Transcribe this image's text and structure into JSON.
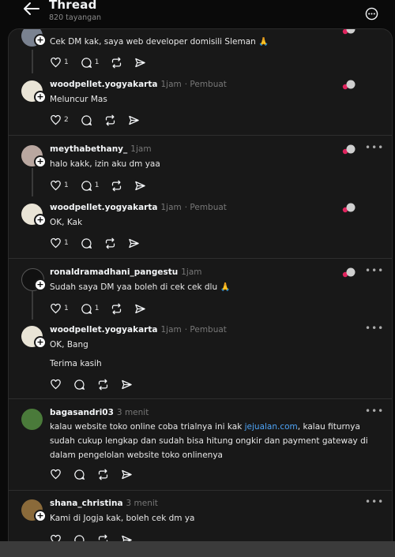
{
  "header": {
    "title": "Thread",
    "views": "820 tayangan"
  },
  "posts": [
    {
      "user": "",
      "time": "",
      "role": "",
      "text": "Cek DM kak, saya web developer domisili Sleman 🙏",
      "likes": "1",
      "replies": "1"
    },
    {
      "user": "woodpellet.yogyakarta",
      "time": "1jam",
      "role": "· Pembuat",
      "text": "Meluncur Mas",
      "likes": "2",
      "replies": ""
    },
    {
      "user": "meythabethany_",
      "time": "1jam",
      "role": "",
      "text": "halo kakk, izin aku dm yaa",
      "likes": "1",
      "replies": "1"
    },
    {
      "user": "woodpellet.yogyakarta",
      "time": "1jam",
      "role": "· Pembuat",
      "text": "OK, Kak",
      "likes": "1",
      "replies": ""
    },
    {
      "user": "ronaldramadhani_pangestu",
      "time": "1jam",
      "role": "",
      "text": "Sudah saya DM yaa boleh di cek cek dlu 🙏",
      "likes": "1",
      "replies": "1"
    },
    {
      "user": "woodpellet.yogyakarta",
      "time": "1jam",
      "role": "· Pembuat",
      "text": "OK, Bang",
      "text2": "Terima kasih",
      "likes": "",
      "replies": ""
    },
    {
      "user": "bagasandri03",
      "time": "3 menit",
      "role": "",
      "text_a": "kalau website toko online coba trialnya ini kak ",
      "text_link": "jejualan.com",
      "text_b": ", kalau fiturnya sudah cukup lengkap dan sudah bisa hitung ongkir dan payment gateway di dalam pengelolan website toko onlinenya",
      "likes": "",
      "replies": ""
    },
    {
      "user": "shana_christina",
      "time": "3 menit",
      "role": "",
      "text": "Kami di Jogja kak, boleh cek dm ya",
      "likes": "",
      "replies": ""
    }
  ],
  "icons": {
    "back": "arrow-left-icon",
    "more": "more-circle-icon",
    "like": "heart-icon",
    "reply": "comment-icon",
    "repost": "repost-icon",
    "share": "send-icon"
  }
}
